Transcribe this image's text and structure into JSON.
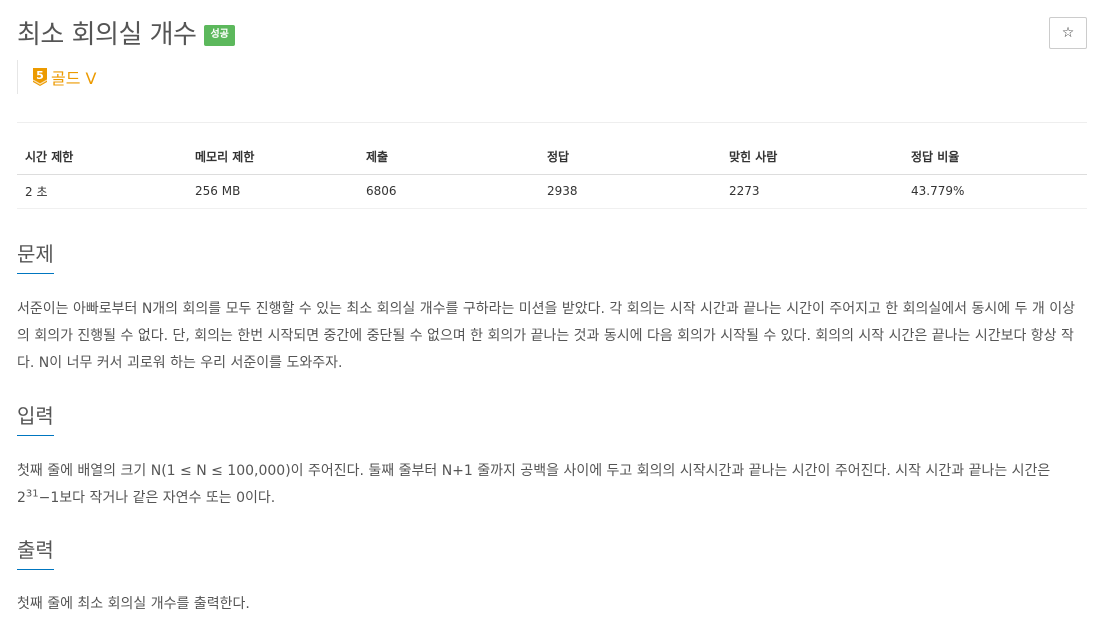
{
  "problem": {
    "title": "최소 회의실 개수",
    "status_badge": "성공",
    "star_icon": "☆",
    "tier": {
      "level_number": "5",
      "label": "골드 V",
      "color": "#ec9a00"
    }
  },
  "info_table": {
    "headers": [
      "시간 제한",
      "메모리 제한",
      "제출",
      "정답",
      "맞힌 사람",
      "정답 비율"
    ],
    "row": [
      "2 초",
      "256 MB",
      "6806",
      "2938",
      "2273",
      "43.779%"
    ]
  },
  "sections": {
    "problem": {
      "title": "문제",
      "body": "서준이는 아빠로부터 N개의 회의를 모두 진행할 수 있는 최소 회의실 개수를 구하라는 미션을 받았다. 각 회의는 시작 시간과 끝나는 시간이 주어지고 한 회의실에서 동시에 두 개 이상의 회의가 진행될 수 없다. 단, 회의는 한번 시작되면 중간에 중단될 수 없으며 한 회의가 끝나는 것과 동시에 다음 회의가 시작될 수 있다. 회의의 시작 시간은 끝나는 시간보다 항상 작다. N이 너무 커서 괴로워 하는 우리 서준이를 도와주자."
    },
    "input": {
      "title": "입력",
      "body_part1": "첫째 줄에 배열의 크기 N(1 ≤ N ≤ 100,000)이 주어진다. 둘째 줄부터 N+1 줄까지 공백을 사이에 두고 회의의 시작시간과 끝나는 시간이 주어진다. 시작 시간과 끝나는 시간은 2",
      "body_sup": "31",
      "body_part2": "−1보다 작거나 같은 자연수 또는 0이다."
    },
    "output": {
      "title": "출력",
      "body": "첫째 줄에 최소 회의실 개수를 출력한다."
    }
  },
  "colors": {
    "badge_success": "#5cb85c",
    "section_underline": "#0076c0",
    "tier_gold": "#ec9a00"
  }
}
